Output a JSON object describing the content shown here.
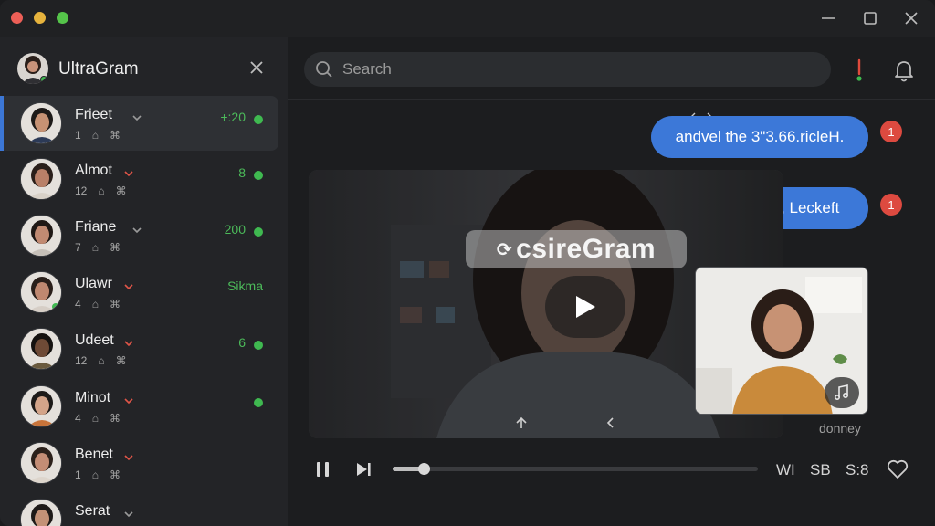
{
  "app": {
    "title": "UltraGram"
  },
  "search": {
    "placeholder": "Search"
  },
  "chats": [
    {
      "name": "Frieet",
      "sub": "1",
      "meta": "+:20",
      "chevron_color": "#9a9a9a",
      "meta_dot": true,
      "avatar_online": false,
      "active": true
    },
    {
      "name": "Almot",
      "sub": "12",
      "meta": "8",
      "chevron_color": "#e05548",
      "meta_dot": true,
      "avatar_online": false,
      "active": false
    },
    {
      "name": "Friane",
      "sub": "7",
      "meta": "200",
      "chevron_color": "#9a9a9a",
      "meta_dot": true,
      "avatar_online": false,
      "active": false
    },
    {
      "name": "Ulawr",
      "sub": "4",
      "meta": "Sikma",
      "chevron_color": "#e05548",
      "meta_dot": false,
      "avatar_online": true,
      "active": false
    },
    {
      "name": "Udeet",
      "sub": "12",
      "meta": "6",
      "chevron_color": "#e05548",
      "meta_dot": true,
      "avatar_online": false,
      "active": false
    },
    {
      "name": "Minot",
      "sub": "4",
      "meta": "",
      "chevron_color": "#e05548",
      "meta_dot": true,
      "avatar_online": false,
      "active": false
    },
    {
      "name": "Benet",
      "sub": "1",
      "meta": "",
      "chevron_color": "#e05548",
      "meta_dot": false,
      "avatar_online": false,
      "active": false
    },
    {
      "name": "Serat",
      "sub": "",
      "meta": "",
      "chevron_color": "#9a9a9a",
      "meta_dot": false,
      "avatar_online": false,
      "active": false
    }
  ],
  "messages": [
    {
      "text": "andvel the 3\"3.66.ricleH.",
      "badge": "1"
    },
    {
      "text": "lorovethen, it, Leckeft",
      "badge": "1"
    }
  ],
  "video": {
    "watermark": "csireGram",
    "pip_caption": "donney",
    "progress": 0.085
  },
  "controls": {
    "label_a": "WI",
    "label_b": "SB",
    "label_c": "S:8"
  },
  "colors": {
    "accent": "#3c78d8",
    "online": "#3fb950",
    "badge": "#dd4a40"
  }
}
